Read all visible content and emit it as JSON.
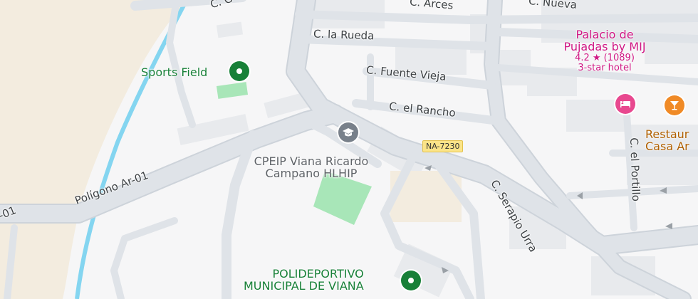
{
  "map": {
    "colors": {
      "background": "#f6f6f7",
      "road": "#dfe3e8",
      "road_outline": "#cdd3da",
      "building": "#e8eaed",
      "park": "#a8e6b8",
      "river": "#84d5f0",
      "sand": "#f3ecdf"
    },
    "streets": {
      "arces": "C. Arces",
      "nueva": "C. Nueva",
      "la_rueda": "C. la Rueda",
      "fuente_vieja": "C. Fuente Vieja",
      "el_rancho": "C. el Rancho",
      "serapio_urra": "C. Serapio Urra",
      "el_portillo": "C. el Portillo",
      "poligono": "Polígono Ar-01",
      "poligono_left": "-01",
      "top_left": "C. G"
    },
    "road_shield": "NA-7230",
    "pois": {
      "sports_field": {
        "name": "Sports Field",
        "icon": "map-pin-icon",
        "color": "#188038"
      },
      "school": {
        "line1": "CPEIP Viana Ricardo",
        "line2": "Campano HLHIP",
        "icon": "graduation-cap-icon",
        "color": "#5f6368"
      },
      "polideportivo": {
        "line1": "POLIDEPORTIVO",
        "line2": "MUNICIPAL DE VIANA",
        "icon": "map-pin-icon",
        "color": "#188038"
      },
      "hotel": {
        "line1": "Palacio de",
        "line2": "Pujadas by MIJ",
        "rating": "4.2 ★ (1089)",
        "type": "3-star hotel",
        "icon": "bed-icon",
        "color": "#e8488f"
      },
      "restaurant": {
        "line1": "Restaur",
        "line2": "Casa Ar",
        "icon": "cocktail-icon",
        "color": "#f08a26"
      }
    }
  }
}
